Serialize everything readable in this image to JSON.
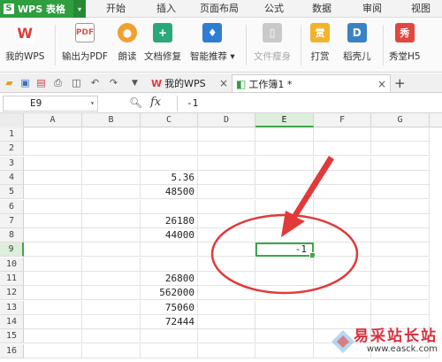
{
  "app": {
    "title": "WPS 表格"
  },
  "menu": [
    "开始",
    "插入",
    "页面布局",
    "公式",
    "数据",
    "审阅",
    "视图"
  ],
  "ribbon": [
    {
      "label": "我的WPS",
      "icon": "wps-logo-icon",
      "color": "#e23a3a"
    },
    {
      "label": "输出为PDF",
      "icon": "pdf-export-icon",
      "color": "#d9534f"
    },
    {
      "label": "朗读",
      "icon": "microphone-icon",
      "color": "#f0a030"
    },
    {
      "label": "文档修复",
      "icon": "document-repair-icon",
      "color": "#2aa87a"
    },
    {
      "label": "智能推荐 ▾",
      "icon": "smart-recommend-icon",
      "color": "#2d7dd2"
    },
    {
      "label": "文件瘦身",
      "icon": "file-slim-icon",
      "color": "#b5b5b5"
    },
    {
      "label": "打赏",
      "icon": "reward-icon",
      "color": "#f2b22a"
    },
    {
      "label": "稻壳儿",
      "icon": "docer-icon",
      "color": "#3b82c4"
    },
    {
      "label": "秀堂H5",
      "icon": "xiutang-icon",
      "color": "#e2463f"
    }
  ],
  "tabs": {
    "mywps": "我的WPS",
    "workbook": "工作簿1 *"
  },
  "namebox": "E9",
  "formula": {
    "fx": "fx",
    "value": "-1"
  },
  "columns": [
    "A",
    "B",
    "C",
    "D",
    "E",
    "F",
    "G"
  ],
  "rows": [
    {
      "n": "1",
      "c": "",
      "e": ""
    },
    {
      "n": "2",
      "c": "",
      "e": ""
    },
    {
      "n": "3",
      "c": "",
      "e": ""
    },
    {
      "n": "4",
      "c": "5.36",
      "e": ""
    },
    {
      "n": "5",
      "c": "48500",
      "e": ""
    },
    {
      "n": "6",
      "c": "",
      "e": ""
    },
    {
      "n": "7",
      "c": "26180",
      "e": ""
    },
    {
      "n": "8",
      "c": "44000",
      "e": ""
    },
    {
      "n": "9",
      "c": "",
      "e": "-1"
    },
    {
      "n": "10",
      "c": "",
      "e": ""
    },
    {
      "n": "11",
      "c": "26800",
      "e": ""
    },
    {
      "n": "12",
      "c": "562000",
      "e": ""
    },
    {
      "n": "13",
      "c": "75060",
      "e": ""
    },
    {
      "n": "14",
      "c": "72444",
      "e": ""
    },
    {
      "n": "15",
      "c": "",
      "e": ""
    },
    {
      "n": "16",
      "c": "",
      "e": ""
    }
  ],
  "selection": {
    "column": "E",
    "row": "9"
  },
  "annotation_color": "#e03a3a",
  "watermark": {
    "title": "易采站长站",
    "url": "www.easck.com"
  }
}
